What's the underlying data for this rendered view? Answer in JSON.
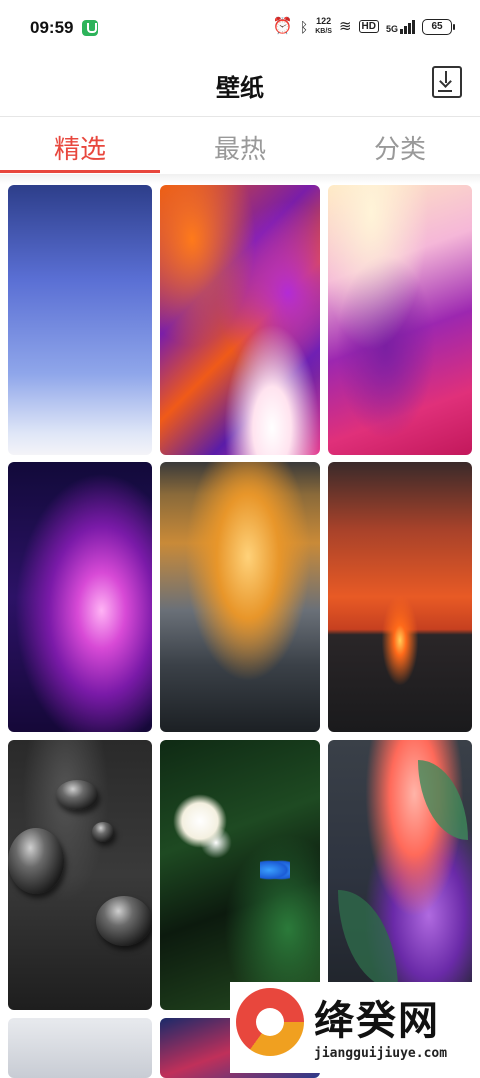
{
  "status_bar": {
    "time": "09:59",
    "net_speed_value": "122",
    "net_speed_unit": "KB/S",
    "hd_label": "HD",
    "signal_label": "5G",
    "battery": "65",
    "icons": [
      "shield-icon",
      "alarm-icon",
      "bluetooth-icon",
      "wifi-icon",
      "signal-icon",
      "battery-icon"
    ]
  },
  "header": {
    "title": "壁纸",
    "download_icon": "download-icon"
  },
  "tabs": [
    {
      "label": "精选",
      "active": true
    },
    {
      "label": "最热",
      "active": false
    },
    {
      "label": "分类",
      "active": false
    }
  ],
  "accent_color": "#e8473d",
  "wallpapers": [
    "blue-gradient",
    "orange-purple-fluid",
    "pastel-marble",
    "purple-galaxy",
    "sunset-clouds",
    "red-sunset-sea",
    "water-drops",
    "jungle-flowers-butterfly",
    "tropical-leaves",
    "light-gray",
    "blue-red-abstract"
  ],
  "watermark": {
    "brand": "绛癸网",
    "url": "jiangguijiuye.com"
  }
}
